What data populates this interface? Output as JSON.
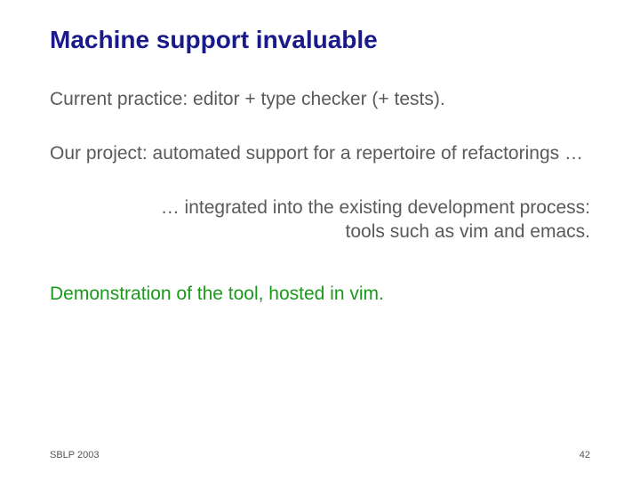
{
  "title": "Machine support invaluable",
  "p1": "Current practice: editor + type checker (+ tests).",
  "p2": "Our project: automated support for a repertoire of refactorings …",
  "p3": "… integrated into the existing development process: tools such as vim and emacs.",
  "p4": "Demonstration of the tool, hosted in vim.",
  "footer_left": "SBLP 2003",
  "footer_right": "42"
}
